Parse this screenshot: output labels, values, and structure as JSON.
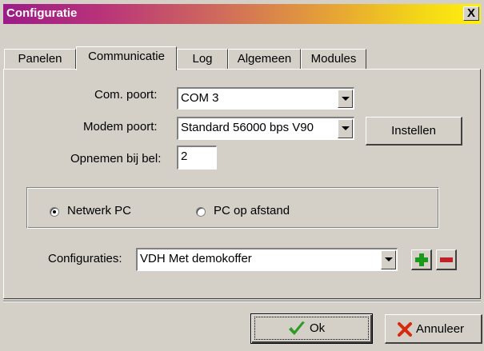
{
  "window": {
    "title": "Configuratie",
    "close_label": "X"
  },
  "tabs": [
    {
      "label": "Panelen",
      "active": false
    },
    {
      "label": "Communicatie",
      "active": true
    },
    {
      "label": "Log",
      "active": false
    },
    {
      "label": "Algemeen",
      "active": false
    },
    {
      "label": "Modules",
      "active": false
    }
  ],
  "form": {
    "com_port": {
      "label": "Com. poort:",
      "value": "COM 3"
    },
    "modem_port": {
      "label": "Modem poort:",
      "value": "Standard 56000 bps V90"
    },
    "instellen_label": "Instellen",
    "opnemen": {
      "label": "Opnemen bij bel:",
      "value": "2"
    }
  },
  "mode": {
    "options": [
      {
        "label": "Netwerk PC",
        "selected": true
      },
      {
        "label": "PC op afstand",
        "selected": false
      }
    ]
  },
  "configuraties": {
    "label": "Configuraties:",
    "value": "VDH Met demokoffer"
  },
  "footer": {
    "ok_label": "Ok",
    "cancel_label": "Annuleer"
  },
  "colors": {
    "title_gradient_start": "#9c1b88",
    "title_gradient_end": "#ffef0f",
    "add_green": "#1a9a1a",
    "remove_red": "#c0202a",
    "ok_check_green": "#2e9c24",
    "cancel_x_red": "#d42a0e"
  },
  "icons": {
    "add": "plus-icon",
    "remove": "minus-icon",
    "ok": "checkmark-icon",
    "cancel": "x-icon"
  }
}
